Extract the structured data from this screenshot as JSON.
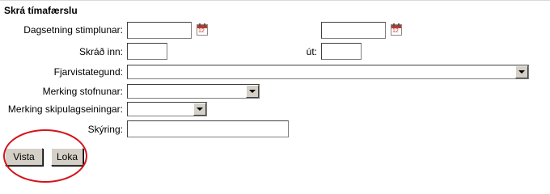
{
  "form": {
    "title": "Skrá tímafærslu"
  },
  "fields": {
    "date_label": "Dagsetning stimplunar:",
    "date_value_1": "",
    "date_value_2": "",
    "in_label": "Skráð inn:",
    "in_value": "",
    "out_label": "út:",
    "out_value": "",
    "absence_label": "Fjarvistategund:",
    "absence_value": "",
    "institution_label": "Merking stofnunar:",
    "institution_value": "",
    "orgunit_label": "Merking skipulagseiningar:",
    "orgunit_value": "",
    "explanation_label": "Skýring:",
    "explanation_value": ""
  },
  "calendar_icon": {
    "icon": "calendar-icon",
    "day": "12",
    "color": "#c0392b"
  },
  "buttons": {
    "save": "Vista",
    "close": "Loka"
  },
  "annotation": {
    "color": "#d4141c"
  }
}
